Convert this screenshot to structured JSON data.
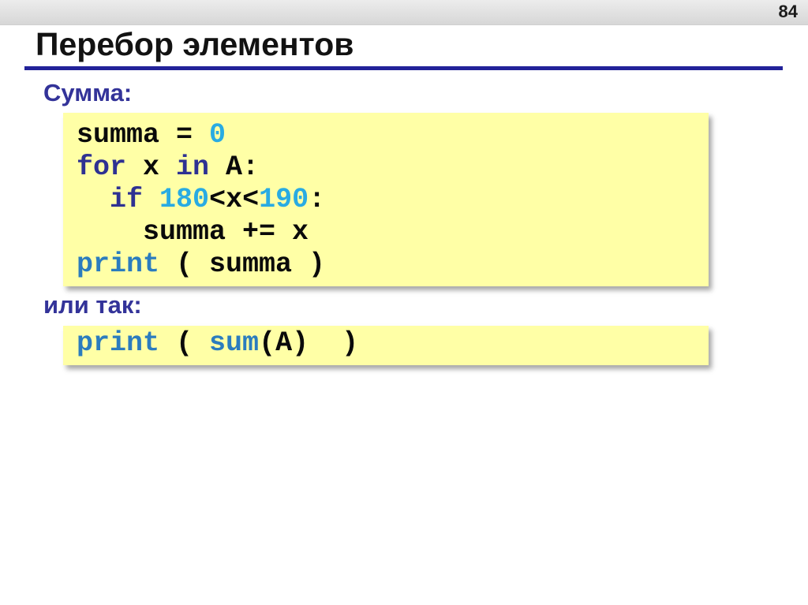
{
  "header": {
    "page_number": "84"
  },
  "title": "Перебор элементов",
  "sections": [
    {
      "label": "Сумма:",
      "code": [
        [
          {
            "c": "p",
            "t": "summa = "
          },
          {
            "c": "n",
            "t": "0"
          }
        ],
        [
          {
            "c": "k",
            "t": "for"
          },
          {
            "c": "p",
            "t": " x "
          },
          {
            "c": "k",
            "t": "in"
          },
          {
            "c": "p",
            "t": " A:"
          }
        ],
        [
          {
            "c": "p",
            "t": "  "
          },
          {
            "c": "k",
            "t": "if"
          },
          {
            "c": "p",
            "t": " "
          },
          {
            "c": "n",
            "t": "180"
          },
          {
            "c": "p",
            "t": "<x<"
          },
          {
            "c": "n",
            "t": "190"
          },
          {
            "c": "p",
            "t": ":"
          }
        ],
        [
          {
            "c": "p",
            "t": "    summa += x"
          }
        ],
        [
          {
            "c": "f",
            "t": "print"
          },
          {
            "c": "p",
            "t": " ( summa )"
          }
        ]
      ]
    },
    {
      "label": "или так:",
      "code": [
        [
          {
            "c": "f",
            "t": "print"
          },
          {
            "c": "p",
            "t": " ( "
          },
          {
            "c": "f",
            "t": "sum"
          },
          {
            "c": "p",
            "t": "(A)  )"
          }
        ]
      ]
    }
  ],
  "colors": {
    "code_background": "#FFFFA6",
    "keyword": "#2E3192",
    "builtin_function": "#2B7CBE",
    "number": "#29ABE2",
    "heading": "#333399",
    "title_underline": "#222299",
    "topbar_background": "#DCDCDC"
  }
}
